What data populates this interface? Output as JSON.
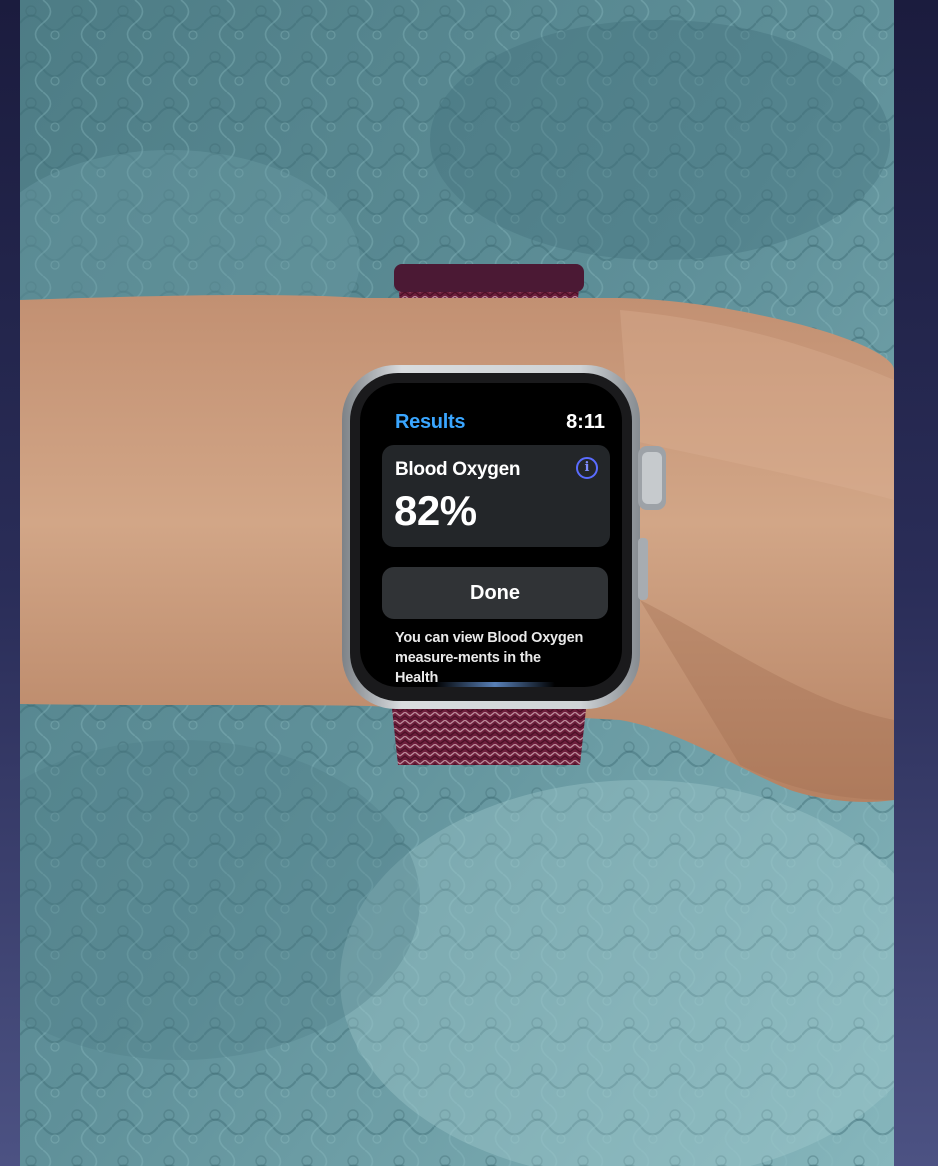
{
  "watch": {
    "back_label": "Results",
    "time": "8:11",
    "measurement_title": "Blood Oxygen",
    "measurement_value": "82%",
    "done_label": "Done",
    "note": "You can view Blood Oxygen measure-ments in the Health"
  },
  "colors": {
    "accent": "#3aa6ff",
    "info": "#5a6cff",
    "card": "#232629",
    "button": "#303336",
    "band": "#6e1e3c"
  },
  "icons": {
    "info": "info-icon"
  }
}
